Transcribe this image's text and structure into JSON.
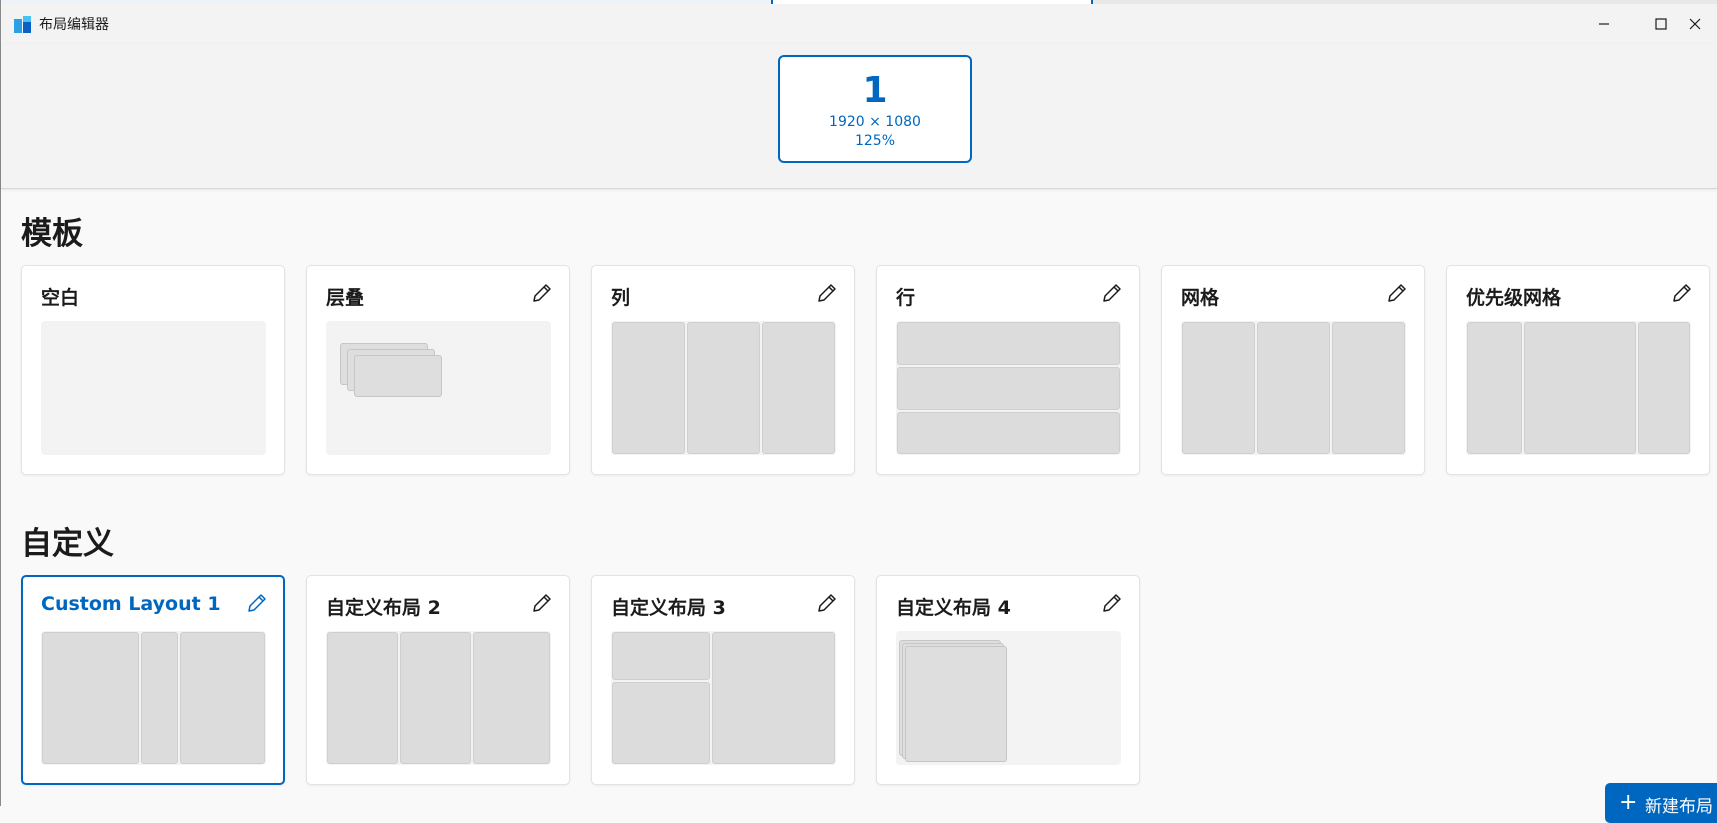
{
  "window": {
    "title": "布局编辑器",
    "accent_color": "#0067c0",
    "controls": [
      "minimize-icon",
      "maximize-icon",
      "close-icon"
    ]
  },
  "monitor": {
    "number": "1",
    "resolution": "1920 × 1080",
    "scale": "125%"
  },
  "templates": {
    "section_title": "模板",
    "items": [
      {
        "title": "空白",
        "editable": false
      },
      {
        "title": "层叠",
        "editable": true
      },
      {
        "title": "列",
        "editable": true
      },
      {
        "title": "行",
        "editable": true
      },
      {
        "title": "网格",
        "editable": true
      },
      {
        "title": "优先级网格",
        "editable": true
      }
    ]
  },
  "custom": {
    "section_title": "自定义",
    "items": [
      {
        "title": "Custom Layout 1",
        "selected": true
      },
      {
        "title": "自定义布局 2"
      },
      {
        "title": "自定义布局 3"
      },
      {
        "title": "自定义布局 4"
      }
    ]
  },
  "new_layout_button": {
    "label": "新建布局"
  }
}
